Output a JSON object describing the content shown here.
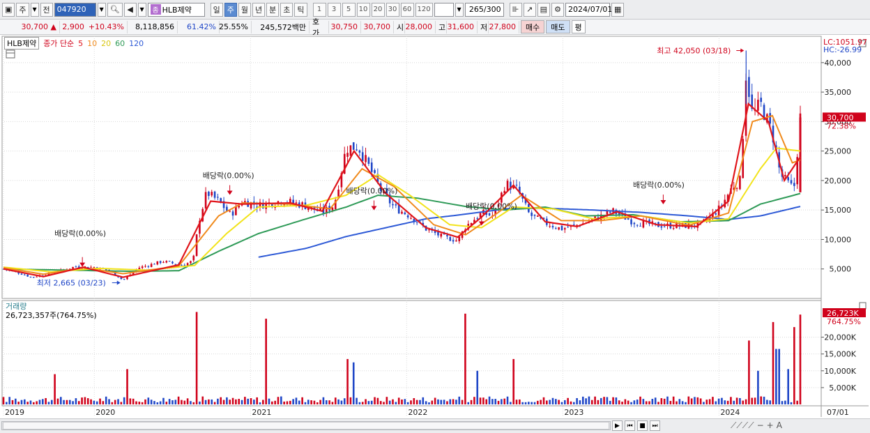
{
  "toolbar": {
    "market": "주",
    "prev_label": "전",
    "code": "047920",
    "jong_badge": "종",
    "stock_name": "HLB제약",
    "periods": [
      "일",
      "주",
      "월",
      "년",
      "분",
      "초",
      "틱"
    ],
    "selected_period": "주",
    "intervals": [
      "1",
      "3",
      "5",
      "10",
      "20",
      "30",
      "60",
      "120"
    ],
    "count": "265",
    "count_total": "/300",
    "date": "2024/07/01"
  },
  "quote": {
    "price": "30,700",
    "up_arrow": "▲",
    "change": "2,900",
    "change_pct": "+10.43%",
    "volume": "8,118,856",
    "vol_ratio": "61.42%",
    "turnover": "25.55%",
    "amount": "245,572백만",
    "hoga_label": "호가",
    "hoga_ask": "30,750",
    "hoga_bid": "30,700",
    "open_label": "시",
    "open": "28,000",
    "high_label": "고",
    "high": "31,600",
    "low_label": "저",
    "low": "27,800",
    "buy_label": "매수",
    "sell_label": "매도",
    "flat_label": "평"
  },
  "legend": {
    "name": "HLB제약",
    "title": "종가 단순",
    "ma5": "5",
    "ma10": "10",
    "ma20": "20",
    "ma60": "60",
    "ma120": "120"
  },
  "volume_legend": {
    "title": "거래량",
    "value": "26,723,357주(764.75%)"
  },
  "right_axis": {
    "lc": "LC:1051.97",
    "hc": "HC:-26.99",
    "price_tag": "30,700",
    "price_pct": "72.38%",
    "vol_tag": "26,723K",
    "vol_pct": "764.75%",
    "last_date": "07/01"
  },
  "colors": {
    "up": "#d0021b",
    "down": "#1f46c7",
    "ma5": "#e0151b",
    "ma10": "#f08a1c",
    "ma20": "#f2e31a",
    "ma60": "#2e9a57",
    "ma120": "#2d59d6"
  },
  "chart_data": {
    "type": "candlestick",
    "price_axis": {
      "ticks": [
        "5,000",
        "10,000",
        "15,000",
        "20,000",
        "25,000",
        "30,000",
        "35,000",
        "40,000"
      ],
      "values": [
        5000,
        10000,
        15000,
        20000,
        25000,
        30000,
        35000,
        40000
      ]
    },
    "volume_axis": {
      "ticks": [
        "5,000K",
        "10,000K",
        "15,000K",
        "20,000K"
      ],
      "values": [
        5000,
        10000,
        15000,
        20000
      ]
    },
    "x_axis": {
      "labels": [
        "2019",
        "2020",
        "2021",
        "2022",
        "2023",
        "2024"
      ]
    },
    "annotations": [
      {
        "text": "최고 42,050 (03/18)",
        "kind": "high",
        "value": 42050
      },
      {
        "text": "최저 2,665 (03/23)",
        "kind": "low",
        "value": 2665
      },
      {
        "text": "배당락(0.00%)",
        "kind": "dividend",
        "year": "2019"
      },
      {
        "text": "배당락(0.00%)",
        "kind": "dividend",
        "year": "2020"
      },
      {
        "text": "배당락(0.00%)",
        "kind": "dividend",
        "year": "2021"
      },
      {
        "text": "배당락(0.00%)",
        "kind": "dividend",
        "year": "2022"
      },
      {
        "text": "배당락(0.00%)",
        "kind": "dividend",
        "year": "2023"
      }
    ],
    "price_series": [
      {
        "t": 0.0,
        "p": 5000
      },
      {
        "t": 0.02,
        "p": 4300
      },
      {
        "t": 0.035,
        "p": 3600
      },
      {
        "t": 0.06,
        "p": 4300
      },
      {
        "t": 0.09,
        "p": 5400
      },
      {
        "t": 0.115,
        "p": 5300
      },
      {
        "t": 0.135,
        "p": 4600
      },
      {
        "t": 0.15,
        "p": 3100
      },
      {
        "t": 0.17,
        "p": 5200
      },
      {
        "t": 0.2,
        "p": 6300
      },
      {
        "t": 0.225,
        "p": 5600
      },
      {
        "t": 0.238,
        "p": 6400
      },
      {
        "t": 0.245,
        "p": 13000
      },
      {
        "t": 0.255,
        "p": 18000
      },
      {
        "t": 0.27,
        "p": 16500
      },
      {
        "t": 0.285,
        "p": 14200
      },
      {
        "t": 0.3,
        "p": 16500
      },
      {
        "t": 0.32,
        "p": 15800
      },
      {
        "t": 0.35,
        "p": 16600
      },
      {
        "t": 0.375,
        "p": 15900
      },
      {
        "t": 0.4,
        "p": 14600
      },
      {
        "t": 0.415,
        "p": 15800
      },
      {
        "t": 0.43,
        "p": 25500
      },
      {
        "t": 0.445,
        "p": 25800
      },
      {
        "t": 0.46,
        "p": 22000
      },
      {
        "t": 0.475,
        "p": 18000
      },
      {
        "t": 0.49,
        "p": 15500
      },
      {
        "t": 0.51,
        "p": 14000
      },
      {
        "t": 0.53,
        "p": 11800
      },
      {
        "t": 0.55,
        "p": 10500
      },
      {
        "t": 0.57,
        "p": 9800
      },
      {
        "t": 0.58,
        "p": 12200
      },
      {
        "t": 0.6,
        "p": 14500
      },
      {
        "t": 0.615,
        "p": 14000
      },
      {
        "t": 0.63,
        "p": 19500
      },
      {
        "t": 0.645,
        "p": 18500
      },
      {
        "t": 0.66,
        "p": 14200
      },
      {
        "t": 0.68,
        "p": 12800
      },
      {
        "t": 0.7,
        "p": 11800
      },
      {
        "t": 0.73,
        "p": 12800
      },
      {
        "t": 0.765,
        "p": 14800
      },
      {
        "t": 0.79,
        "p": 13000
      },
      {
        "t": 0.82,
        "p": 12400
      },
      {
        "t": 0.85,
        "p": 12300
      },
      {
        "t": 0.875,
        "p": 12500
      },
      {
        "t": 0.89,
        "p": 14200
      },
      {
        "t": 0.9,
        "p": 15500
      },
      {
        "t": 0.915,
        "p": 19000
      },
      {
        "t": 0.925,
        "p": 20000
      },
      {
        "t": 0.932,
        "p": 38500
      },
      {
        "t": 0.94,
        "p": 31000
      },
      {
        "t": 0.95,
        "p": 33000
      },
      {
        "t": 0.965,
        "p": 28000
      },
      {
        "t": 0.975,
        "p": 21000
      },
      {
        "t": 0.985,
        "p": 19500
      },
      {
        "t": 0.992,
        "p": 18500
      },
      {
        "t": 1.0,
        "p": 30700
      }
    ],
    "ma_series": {
      "ma5": [
        {
          "t": 0.0,
          "p": 5000
        },
        {
          "t": 0.05,
          "p": 3700
        },
        {
          "t": 0.1,
          "p": 5300
        },
        {
          "t": 0.15,
          "p": 3600
        },
        {
          "t": 0.22,
          "p": 5700
        },
        {
          "t": 0.26,
          "p": 16500
        },
        {
          "t": 0.3,
          "p": 16000
        },
        {
          "t": 0.36,
          "p": 16200
        },
        {
          "t": 0.4,
          "p": 14800
        },
        {
          "t": 0.44,
          "p": 25000
        },
        {
          "t": 0.48,
          "p": 17800
        },
        {
          "t": 0.53,
          "p": 12000
        },
        {
          "t": 0.57,
          "p": 10400
        },
        {
          "t": 0.6,
          "p": 13800
        },
        {
          "t": 0.64,
          "p": 19200
        },
        {
          "t": 0.68,
          "p": 13000
        },
        {
          "t": 0.72,
          "p": 12200
        },
        {
          "t": 0.77,
          "p": 14700
        },
        {
          "t": 0.82,
          "p": 12500
        },
        {
          "t": 0.87,
          "p": 12200
        },
        {
          "t": 0.91,
          "p": 16500
        },
        {
          "t": 0.935,
          "p": 33000
        },
        {
          "t": 0.96,
          "p": 30000
        },
        {
          "t": 0.98,
          "p": 20000
        },
        {
          "t": 1.0,
          "p": 24000
        }
      ],
      "ma10": [
        {
          "t": 0.0,
          "p": 5200
        },
        {
          "t": 0.05,
          "p": 4100
        },
        {
          "t": 0.1,
          "p": 5200
        },
        {
          "t": 0.15,
          "p": 4200
        },
        {
          "t": 0.22,
          "p": 5500
        },
        {
          "t": 0.27,
          "p": 14000
        },
        {
          "t": 0.3,
          "p": 16200
        },
        {
          "t": 0.36,
          "p": 16000
        },
        {
          "t": 0.41,
          "p": 15200
        },
        {
          "t": 0.45,
          "p": 22000
        },
        {
          "t": 0.49,
          "p": 19000
        },
        {
          "t": 0.54,
          "p": 12500
        },
        {
          "t": 0.58,
          "p": 10800
        },
        {
          "t": 0.62,
          "p": 14500
        },
        {
          "t": 0.65,
          "p": 17500
        },
        {
          "t": 0.7,
          "p": 13200
        },
        {
          "t": 0.75,
          "p": 13200
        },
        {
          "t": 0.8,
          "p": 14000
        },
        {
          "t": 0.86,
          "p": 12400
        },
        {
          "t": 0.91,
          "p": 14500
        },
        {
          "t": 0.94,
          "p": 30000
        },
        {
          "t": 0.965,
          "p": 31000
        },
        {
          "t": 0.99,
          "p": 23000
        },
        {
          "t": 1.0,
          "p": 23500
        }
      ],
      "ma20": [
        {
          "t": 0.0,
          "p": 5300
        },
        {
          "t": 0.06,
          "p": 4500
        },
        {
          "t": 0.12,
          "p": 5100
        },
        {
          "t": 0.18,
          "p": 4800
        },
        {
          "t": 0.24,
          "p": 5600
        },
        {
          "t": 0.28,
          "p": 11000
        },
        {
          "t": 0.32,
          "p": 15500
        },
        {
          "t": 0.38,
          "p": 15800
        },
        {
          "t": 0.43,
          "p": 17500
        },
        {
          "t": 0.47,
          "p": 21000
        },
        {
          "t": 0.51,
          "p": 17500
        },
        {
          "t": 0.56,
          "p": 12500
        },
        {
          "t": 0.6,
          "p": 12000
        },
        {
          "t": 0.64,
          "p": 15500
        },
        {
          "t": 0.69,
          "p": 15200
        },
        {
          "t": 0.74,
          "p": 13500
        },
        {
          "t": 0.8,
          "p": 14000
        },
        {
          "t": 0.86,
          "p": 12800
        },
        {
          "t": 0.91,
          "p": 13500
        },
        {
          "t": 0.95,
          "p": 22000
        },
        {
          "t": 0.97,
          "p": 25500
        },
        {
          "t": 1.0,
          "p": 25000
        }
      ],
      "ma60": [
        {
          "t": 0.0,
          "p": 5000
        },
        {
          "t": 0.08,
          "p": 4800
        },
        {
          "t": 0.16,
          "p": 4600
        },
        {
          "t": 0.22,
          "p": 4700
        },
        {
          "t": 0.27,
          "p": 8000
        },
        {
          "t": 0.32,
          "p": 11000
        },
        {
          "t": 0.38,
          "p": 13500
        },
        {
          "t": 0.43,
          "p": 15500
        },
        {
          "t": 0.47,
          "p": 17500
        },
        {
          "t": 0.52,
          "p": 17000
        },
        {
          "t": 0.58,
          "p": 15600
        },
        {
          "t": 0.63,
          "p": 15000
        },
        {
          "t": 0.68,
          "p": 15500
        },
        {
          "t": 0.73,
          "p": 14000
        },
        {
          "t": 0.79,
          "p": 14200
        },
        {
          "t": 0.85,
          "p": 13000
        },
        {
          "t": 0.91,
          "p": 13200
        },
        {
          "t": 0.95,
          "p": 16000
        },
        {
          "t": 1.0,
          "p": 17800
        }
      ],
      "ma120": [
        {
          "t": 0.32,
          "p": 7000
        },
        {
          "t": 0.38,
          "p": 8500
        },
        {
          "t": 0.43,
          "p": 10500
        },
        {
          "t": 0.48,
          "p": 12000
        },
        {
          "t": 0.53,
          "p": 13500
        },
        {
          "t": 0.58,
          "p": 14300
        },
        {
          "t": 0.63,
          "p": 15200
        },
        {
          "t": 0.68,
          "p": 15300
        },
        {
          "t": 0.74,
          "p": 15000
        },
        {
          "t": 0.8,
          "p": 14600
        },
        {
          "t": 0.86,
          "p": 14000
        },
        {
          "t": 0.91,
          "p": 13400
        },
        {
          "t": 0.95,
          "p": 14000
        },
        {
          "t": 1.0,
          "p": 15600
        }
      ]
    },
    "volume_peaks": [
      {
        "t": 0.065,
        "v": 9000,
        "up": true
      },
      {
        "t": 0.155,
        "v": 10500,
        "up": true
      },
      {
        "t": 0.243,
        "v": 27500,
        "up": true
      },
      {
        "t": 0.33,
        "v": 25500,
        "up": true
      },
      {
        "t": 0.432,
        "v": 13500,
        "up": true
      },
      {
        "t": 0.44,
        "v": 12500,
        "up": false
      },
      {
        "t": 0.58,
        "v": 27000,
        "up": true
      },
      {
        "t": 0.595,
        "v": 10000,
        "up": false
      },
      {
        "t": 0.64,
        "v": 13500,
        "up": true
      },
      {
        "t": 0.935,
        "v": 19000,
        "up": true
      },
      {
        "t": 0.948,
        "v": 10000,
        "up": false
      },
      {
        "t": 0.965,
        "v": 24500,
        "up": true
      },
      {
        "t": 0.972,
        "v": 16500,
        "up": false
      },
      {
        "t": 0.985,
        "v": 10500,
        "up": false
      },
      {
        "t": 0.993,
        "v": 23000,
        "up": true
      },
      {
        "t": 1.0,
        "v": 26723,
        "up": true
      }
    ]
  }
}
